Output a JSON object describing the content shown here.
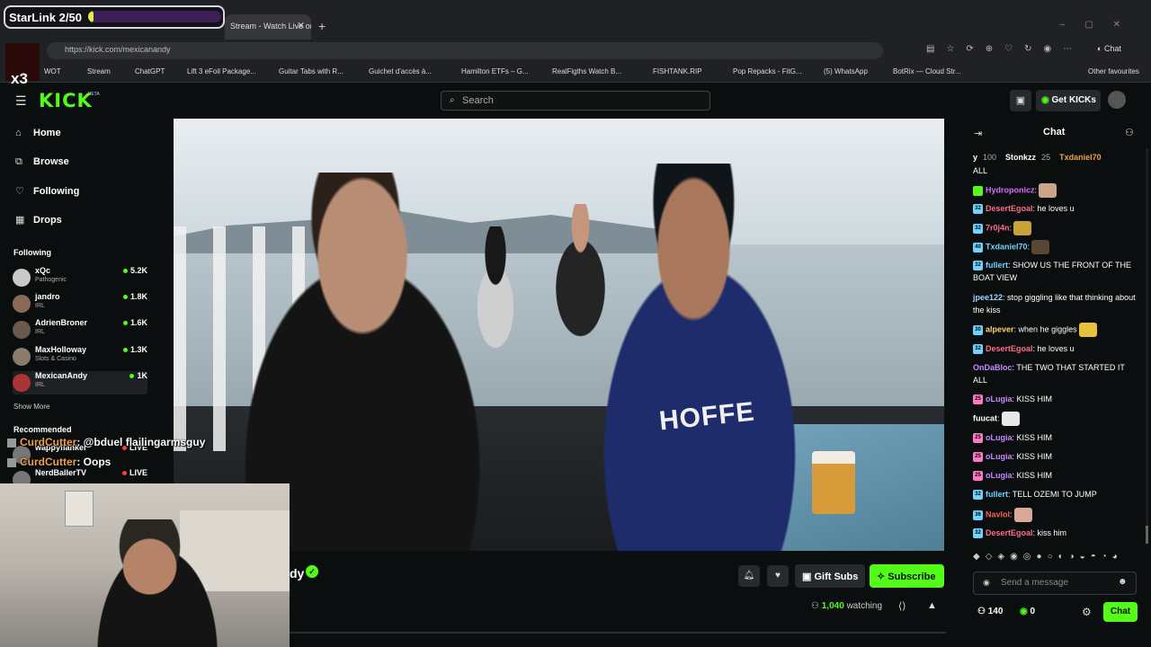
{
  "overlay": {
    "starlink_label": "StarLink 2/50",
    "starlink_progress": 0.04,
    "logo_text": "x3",
    "chat": [
      {
        "user": "CurdCutter",
        "text": ": @bduel flailingarmsguy"
      },
      {
        "user": "CurdCutter",
        "text": ": Oops"
      }
    ]
  },
  "browser": {
    "tab_title": "Stream - Watch Live on",
    "url": "https://kick.com/mexicanandy",
    "copilot_label": "Chat",
    "bookmarks": [
      "WOT",
      "Stream",
      "ChatGPT",
      "Lift 3 eFoil Package...",
      "Guitar Tabs with R...",
      "Guichet d'accès à...",
      "Hamilton ETFs – G...",
      "RealFigths Watch B...",
      "FISHTANK.RIP",
      "Pop Repacks - FitG...",
      "(5) WhatsApp",
      "BotRix — Cloud Str...",
      "Other favourites"
    ]
  },
  "header": {
    "logo": "KICK",
    "beta": "BETA",
    "search_placeholder": "Search",
    "get_kicks": "Get KICKs"
  },
  "sidebar": {
    "nav": [
      {
        "icon": "⌂",
        "label": "Home"
      },
      {
        "icon": "⧉",
        "label": "Browse"
      },
      {
        "icon": "♡",
        "label": "Following"
      },
      {
        "icon": "▦",
        "label": "Drops"
      }
    ],
    "following_heading": "Following",
    "channels": [
      {
        "name": "xQc",
        "category": "Pathogenic",
        "viewers": "5.2K"
      },
      {
        "name": "jandro",
        "category": "IRL",
        "viewers": "1.8K"
      },
      {
        "name": "AdrienBroner",
        "category": "IRL",
        "viewers": "1.6K"
      },
      {
        "name": "MaxHolloway",
        "category": "Slots & Casino",
        "viewers": "1.3K"
      },
      {
        "name": "MexicanAndy",
        "category": "IRL",
        "viewers": "1K"
      }
    ],
    "show_more": "Show More",
    "recommended_heading": "Recommended",
    "recommended": [
      {
        "name": "wappyflanker",
        "badge": "LIVE"
      },
      {
        "name": "NerdBallerTV",
        "badge": "LIVE"
      }
    ]
  },
  "video": {
    "jersey_text": "HOFFE"
  },
  "stream": {
    "streamer_tail": "dy",
    "gift_subs": "Gift Subs",
    "subscribe": "Subscribe",
    "watching_count": "1,040",
    "watching_label": "watching"
  },
  "chat": {
    "title": "Chat",
    "gifters": [
      {
        "name": "y",
        "count": "100"
      },
      {
        "name": "Stonkzz",
        "count": "25"
      },
      {
        "name": "Txdaniel70",
        "count": ""
      }
    ],
    "messages": [
      {
        "badge": "",
        "badge_color": "",
        "user": "",
        "color": "#ffffff",
        "text": "ALL",
        "emote": ""
      },
      {
        "badge": "",
        "badge_color": "#53fc18",
        "user": "Hydroponicz",
        "color": "#d36bff",
        "text": "",
        "emote": "#c9a58a"
      },
      {
        "badge": "32",
        "badge_color": "#6fd3ff",
        "user": "DesertEgoal",
        "color": "#ff6b8a",
        "text": " he loves u",
        "emote": ""
      },
      {
        "badge": "32",
        "badge_color": "#6fd3ff",
        "user": "7r0j4n",
        "color": "#ff6b8a",
        "text": "",
        "emote": "#c8a13a"
      },
      {
        "badge": "40",
        "badge_color": "#6fd3ff",
        "user": "Txdaniel70",
        "color": "#6fd3ff",
        "text": "",
        "emote": "#5a4634"
      },
      {
        "badge": "32",
        "badge_color": "#6fd3ff",
        "user": "fullert",
        "color": "#6fd3ff",
        "text": " SHOW US THE FRONT OF THE BOAT VIEW",
        "emote": ""
      },
      {
        "badge": "",
        "badge_color": "",
        "user": "jpee122",
        "color": "#9fd3ff",
        "text": " stop giggling like that thinking about the kiss",
        "emote": ""
      },
      {
        "badge": "30",
        "badge_color": "#6fd3ff",
        "user": "alpever",
        "color": "#ffd36b",
        "text": " when he giggles",
        "emote": "#e5c23a"
      },
      {
        "badge": "32",
        "badge_color": "#6fd3ff",
        "user": "DesertEgoal",
        "color": "#ff6b8a",
        "text": " he loves u",
        "emote": ""
      },
      {
        "badge": "",
        "badge_color": "",
        "user": "OnDaBloc",
        "color": "#c58bff",
        "text": " THE TWO THAT STARTED IT ALL",
        "emote": ""
      },
      {
        "badge": "25",
        "badge_color": "#ff78c4",
        "user": "oLugia",
        "color": "#c58bff",
        "text": " KISS HIM",
        "emote": ""
      },
      {
        "badge": "",
        "badge_color": "",
        "user": "fuucat",
        "color": "#ffffff",
        "text": "",
        "emote": "#e8e8e8"
      },
      {
        "badge": "25",
        "badge_color": "#ff78c4",
        "user": "oLugia",
        "color": "#c58bff",
        "text": " KISS HIM",
        "emote": ""
      },
      {
        "badge": "25",
        "badge_color": "#ff78c4",
        "user": "oLugia",
        "color": "#c58bff",
        "text": " KISS HIM",
        "emote": ""
      },
      {
        "badge": "25",
        "badge_color": "#ff78c4",
        "user": "oLugia",
        "color": "#c58bff",
        "text": " KISS HIM",
        "emote": ""
      },
      {
        "badge": "32",
        "badge_color": "#6fd3ff",
        "user": "fullert",
        "color": "#6fd3ff",
        "text": " TELL OZEMI TO JUMP",
        "emote": ""
      },
      {
        "badge": "36",
        "badge_color": "#6fd3ff",
        "user": "Navlol",
        "color": "#ff5a5a",
        "text": "",
        "emote": "#d8a898"
      },
      {
        "badge": "32",
        "badge_color": "#6fd3ff",
        "user": "DesertEgoal",
        "color": "#ff6b8a",
        "text": " kiss him",
        "emote": ""
      }
    ],
    "input_placeholder": "Send a message",
    "kicks_count": "140",
    "coins_count": "0",
    "chat_button": "Chat"
  }
}
